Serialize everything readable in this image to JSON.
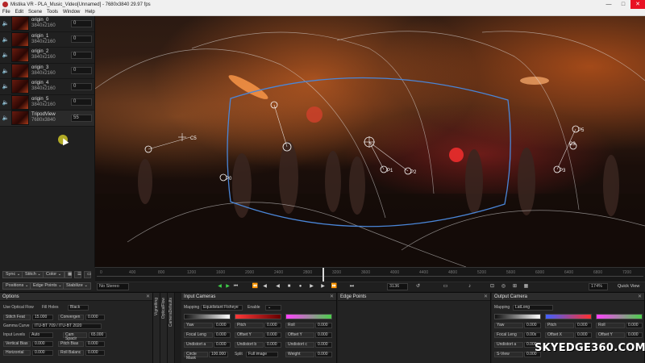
{
  "window": {
    "title": "Mistika VR - PLA_Music_Video[Unnamed] - 7680x3840 29.97 fps",
    "buttons": {
      "minimize": "—",
      "maximize": "□",
      "close": "✕"
    }
  },
  "menu": [
    "File",
    "Edit",
    "Scene",
    "Tools",
    "Window",
    "Help"
  ],
  "clips": [
    {
      "name": "origin_0",
      "res": "3840x2160",
      "value": "0"
    },
    {
      "name": "origin_1",
      "res": "3840x2160",
      "value": "0"
    },
    {
      "name": "origin_2",
      "res": "3840x2160",
      "value": "0"
    },
    {
      "name": "origin_3",
      "res": "3840x2160",
      "value": "0"
    },
    {
      "name": "origin_4",
      "res": "3840x2160",
      "value": "0"
    },
    {
      "name": "origin_5",
      "res": "3840x2160",
      "value": "0"
    },
    {
      "name": "TripodView",
      "res": "7680x3840",
      "value": "55"
    }
  ],
  "viewer": {
    "camera_labels": [
      "C5",
      "P0",
      "P1",
      "P2",
      "P3",
      "P5",
      "C3"
    ]
  },
  "timeline": {
    "ticks": [
      "0",
      "400",
      "800",
      "1200",
      "1600",
      "2000",
      "2400",
      "2800",
      "3200",
      "3600",
      "4000",
      "4400",
      "4800",
      "5200",
      "5600",
      "6000",
      "6400",
      "6800",
      "7200"
    ]
  },
  "left_tools": {
    "sync": "Sync ⌄",
    "stitch": "Stitch ⌄",
    "color": "Color ⌄",
    "positions": "Positions ⌄",
    "edge_points": "Edge Points ⌄",
    "stabilize": "Stabilize ⌄"
  },
  "transport": {
    "stereo_mode": "No Stereo",
    "frame": "3136",
    "zoom": "174%",
    "quick_view": "Quick View"
  },
  "options_panel": {
    "title": "Options",
    "use_optical_flow": "Use Optical Flow",
    "fill_holes": "Fill Holes",
    "fill_holes_value": "Black",
    "stitch_feather": "Stitch Feat",
    "stitch_feather_value": "15.000",
    "convergence": "Convergen",
    "convergence_value": "0.000",
    "gamma_curve": "Gamma Curve",
    "gamma_curve_value": "ITU-BT 709 / ITU-BT 2020",
    "input_levels": "Input Levels",
    "input_levels_value": "Auto",
    "cam_spacing": "Cam Spacir",
    "cam_spacing_value": "65.000",
    "vertical_bias": "Vertical Bias",
    "vertical_bias_value": "0.000",
    "pitch_bias": "Pitch Bias",
    "pitch_bias_value": "0.000",
    "horizontal": "Horizontal",
    "horizontal_value": "0.000",
    "roll_bias": "Roll Balanc",
    "roll_bias_value": "0.000"
  },
  "side_tabs": [
    "Vignetting",
    "OpticalFlow",
    "CameraDefaults"
  ],
  "input_cameras": {
    "title": "Input Cameras",
    "mapping_label": "Mapping",
    "mapping_value": "Equidistant Fisheye",
    "enable_label": "Enable",
    "yaw": "Yaw",
    "yaw_value": "0.000",
    "pitch": "Pitch",
    "pitch_value": "0.000",
    "roll": "Roll",
    "roll_value": "0.000",
    "focal_length": "Focal Leng",
    "focal_length_value": "0.000",
    "offset_y": "Offset Y",
    "offset_y_value": "0.000",
    "offset_z": "Offset Y",
    "offset_z_value": "0.000",
    "undistort_a": "Undistort a",
    "undistort_a_value": "0.000",
    "undistort_b": "Undistort b",
    "undistort_b_value": "0.000",
    "undistort_c": "Undistort c",
    "undistort_c_value": "0.000",
    "circle_mask": "Circle Mask",
    "circle_mask_value": "100.000",
    "split": "Split",
    "split_value": "Full image",
    "weight": "Weight",
    "weight_value": "0.000"
  },
  "edge_points": {
    "title": "Edge Points"
  },
  "output_camera": {
    "title": "Output Camera",
    "mapping_label": "Mapping",
    "mapping_value": "LatLong",
    "yaw": "Yaw",
    "yaw_value": "0.000",
    "pitch": "Pitch",
    "pitch_value": "0.000",
    "roll": "Roll",
    "roll_value": "0.000",
    "focal_length": "Focal Leng",
    "focal_length_value": "0.00x",
    "offset_x": "Offset X",
    "offset_x_value": "0.000",
    "offset_y": "Offset Y",
    "offset_y_value": "0.000",
    "undistort": "Undistort a",
    "undistort_value": "0.000",
    "s_view": "S-View",
    "s_view_value": "0.000"
  },
  "watermark": "SKYEDGE360.COM",
  "colors": {
    "overlay_blue": "#4a86d8",
    "overlay_white": "#e6e6e6",
    "accent_green": "#3fd04a"
  }
}
